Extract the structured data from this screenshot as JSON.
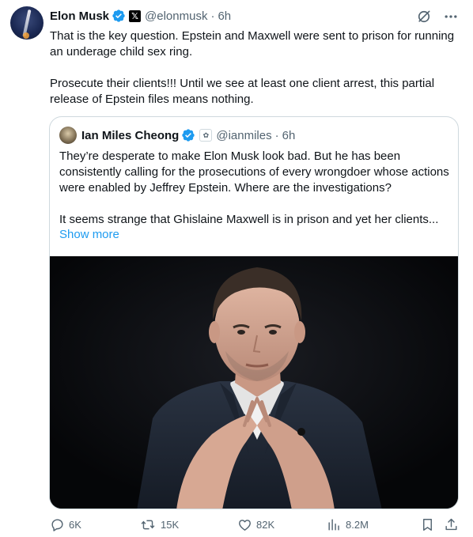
{
  "tweet": {
    "author_name": "Elon Musk",
    "author_handle": "@elonmusk",
    "separator": "·",
    "time": "6h",
    "paragraphs": [
      "That is the key question. Epstein and Maxwell were sent to prison for running an underage child sex ring.",
      "Prosecute their clients!!! Until we see at least one client arrest, this partial release of Epstein files means nothing."
    ]
  },
  "quote": {
    "author_name": "Ian Miles Cheong",
    "author_handle": "@ianmiles",
    "separator": "·",
    "time": "6h",
    "paragraphs": [
      "They’re desperate to make Elon Musk look bad. But he has been consistently calling for the prosecutions of every wrongdoer whose actions were enabled by Jeffrey Epstein. Where are the investigations?",
      "It seems strange that Ghislaine Maxwell is in prison and yet her clients..."
    ],
    "show_more": "Show more"
  },
  "actions": {
    "reply_count": "6K",
    "repost_count": "15K",
    "like_count": "82K",
    "view_count": "8.2M"
  },
  "icons": {
    "verified": "verified-badge-icon",
    "x_affiliate": "x-logo-icon",
    "grok": "grok-icon",
    "more": "more-icon",
    "reply": "reply-icon",
    "repost": "repost-icon",
    "like": "like-icon",
    "views": "views-icon",
    "bookmark": "bookmark-icon",
    "share": "share-icon"
  },
  "colors": {
    "text": "#0f1419",
    "secondary": "#536471",
    "link": "#1d9bf0",
    "verified": "#1d9bf0",
    "border": "#cfd9de"
  }
}
